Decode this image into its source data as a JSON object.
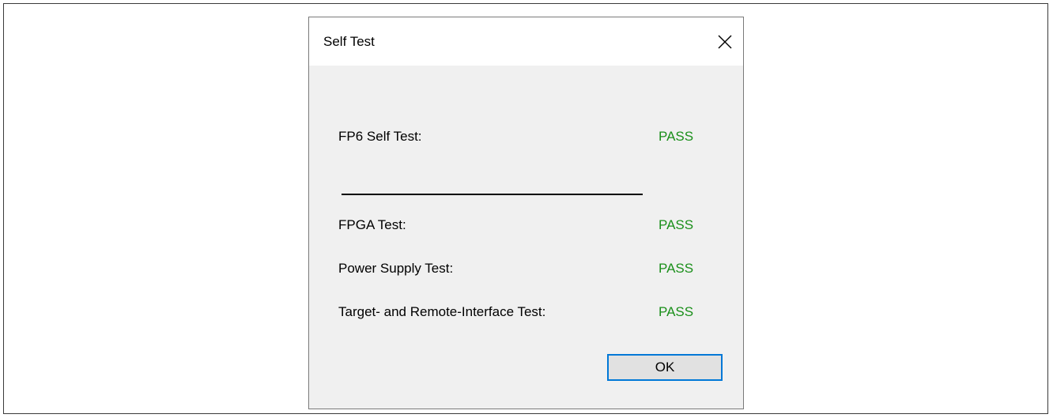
{
  "dialog": {
    "title": "Self Test",
    "close_icon": "close-icon",
    "main_test": {
      "label": "FP6 Self Test:",
      "status": "PASS"
    },
    "sub_tests": [
      {
        "label": "FPGA Test:",
        "status": "PASS"
      },
      {
        "label": "Power Supply Test:",
        "status": "PASS"
      },
      {
        "label": "Target- and Remote-Interface Test:",
        "status": "PASS"
      }
    ],
    "ok_label": "OK",
    "colors": {
      "pass": "#1a8f1a",
      "button_focus_border": "#0078d7",
      "dialog_background": "#f0f0f0"
    }
  }
}
